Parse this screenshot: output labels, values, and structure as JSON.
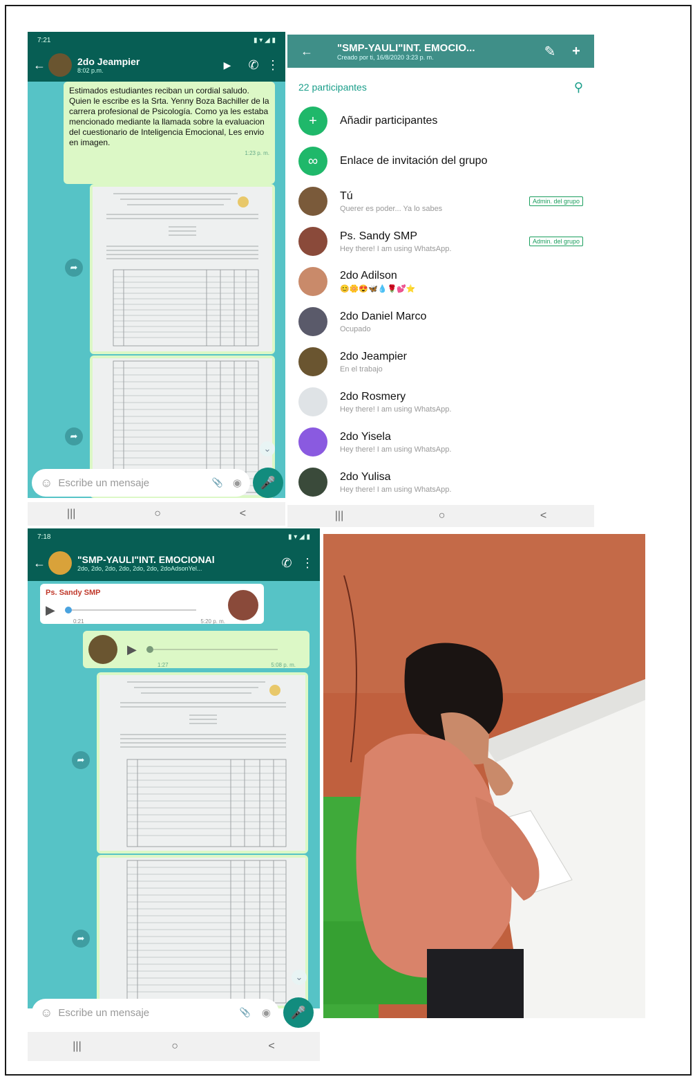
{
  "chat1": {
    "status_time": "7:21",
    "contact_name": "2do Jeampier",
    "contact_time": "8:02 p.m.",
    "message_text": "Estimados estudiantes reciban un cordial saludo. Quien le escribe es la Srta. Yenny Boza Bachiller de la carrera profesional de Psicología. Como ya les estaba mencionado mediante la llamada sobre la evaluacion del cuestionario de Inteligencia Emocional, Les envio en imagen.",
    "message_time": "1:23 p. m.",
    "input_placeholder": "Escribe un mensaje"
  },
  "group_info": {
    "title": "\"SMP-YAULI\"INT. EMOCIO...",
    "subtitle": "Creado por ti, 16/8/2020 3:23 p. m.",
    "participants_count": "22 participantes",
    "add_participants": "Añadir participantes",
    "invite_link": "Enlace de invitación del grupo",
    "participants": [
      {
        "name": "Tú",
        "status": "Querer es poder... Ya lo sabes",
        "badge": "Admin. del grupo",
        "color": "#7a5a3a"
      },
      {
        "name": "Ps. Sandy SMP",
        "status": "Hey there! I am using WhatsApp.",
        "badge": "Admin. del grupo",
        "color": "#8a4a3a"
      },
      {
        "name": "2do Adilson",
        "status": "😊🌼😍🦋💧🌹💕⭐",
        "badge": "",
        "color": "#c98a6a"
      },
      {
        "name": "2do Daniel Marco",
        "status": "Ocupado",
        "badge": "",
        "color": "#5a5a6a"
      },
      {
        "name": "2do Jeampier",
        "status": "En el trabajo",
        "badge": "",
        "color": "#6a5530"
      },
      {
        "name": "2do Rosmery",
        "status": "Hey there! I am using WhatsApp.",
        "badge": "",
        "color": "#dfe3e6"
      },
      {
        "name": "2do Yisela",
        "status": "Hey there! I am using WhatsApp.",
        "badge": "",
        "color": "#8a5ae0"
      },
      {
        "name": "2do Yulisa",
        "status": "Hey there! I am using WhatsApp.",
        "badge": "",
        "color": "#3a4a3a"
      }
    ]
  },
  "chat2": {
    "status_time": "7:18",
    "group_name": "\"SMP-YAULI\"INT. EMOCIONAl",
    "group_members": "2do, 2do, 2do, 2do, 2do, 2do, 2doAdsonYel...",
    "voice1_sender": "Ps. Sandy SMP",
    "voice1_duration": "0:21",
    "voice1_time": "5:20 p. m.",
    "voice2_duration": "1:27",
    "voice2_time": "5:08 p. m.",
    "input_placeholder": "Escribe un mensaje"
  },
  "icons": {
    "back": "←",
    "video": "▶",
    "call": "✆",
    "more": "⋮",
    "forward": "➦",
    "emoji": "☺",
    "attach": "📎",
    "camera": "◉",
    "mic": "🎤",
    "search": "⚲",
    "edit": "✎",
    "add_person": "+",
    "link": "∞",
    "play": "▶",
    "down": "⌄",
    "nav_recent": "|||",
    "nav_home": "○",
    "nav_back": "<"
  }
}
